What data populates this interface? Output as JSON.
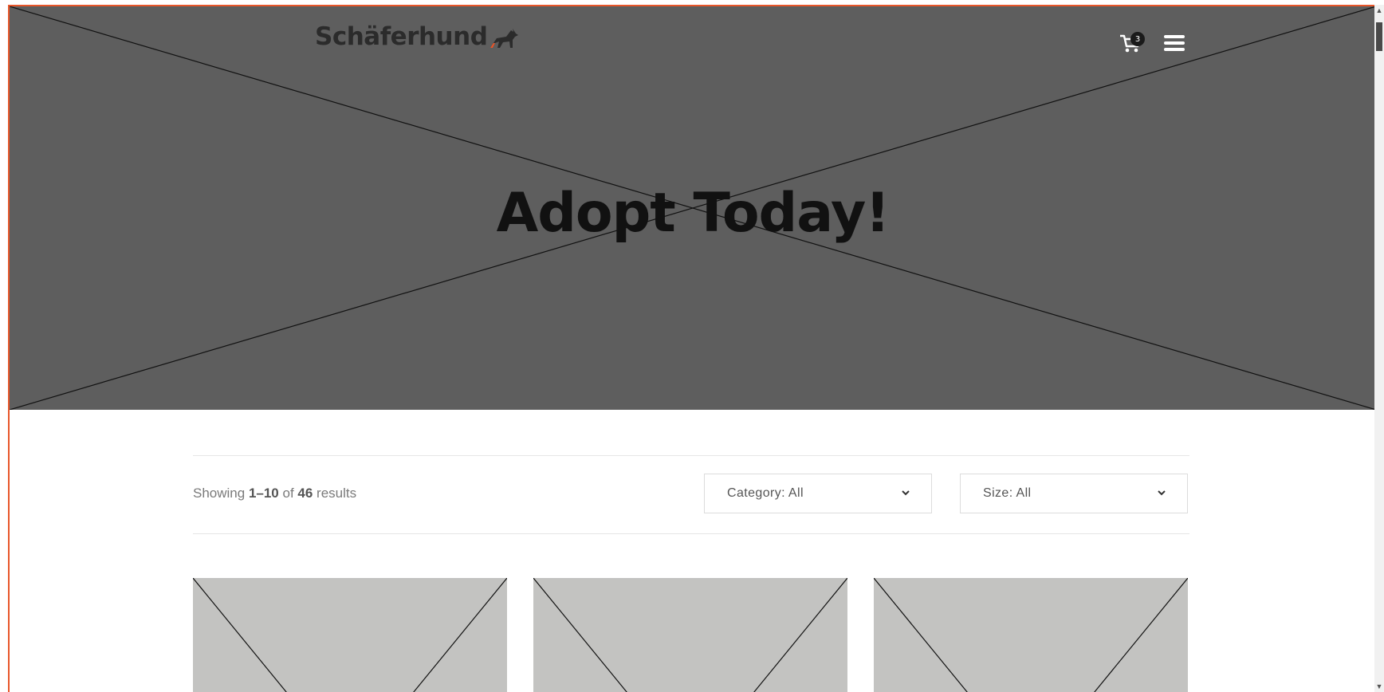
{
  "header": {
    "logo_text": "Schäferhund",
    "cart_count": "3"
  },
  "hero": {
    "title": "Adopt Today!"
  },
  "shop": {
    "results_prefix": "Showing ",
    "results_range": "1–10",
    "results_of": " of ",
    "results_total": "46",
    "results_suffix": " results",
    "category_filter": "Category: All",
    "size_filter": "Size: All"
  },
  "colors": {
    "accent": "#e8562a",
    "hero_bg": "#5e5e5e",
    "card_placeholder": "#c3c3c1"
  },
  "icons": {
    "cart": "cart-icon",
    "menu": "hamburger-menu-icon",
    "dog": "dog-logo-icon",
    "chevron": "chevron-down-icon"
  }
}
